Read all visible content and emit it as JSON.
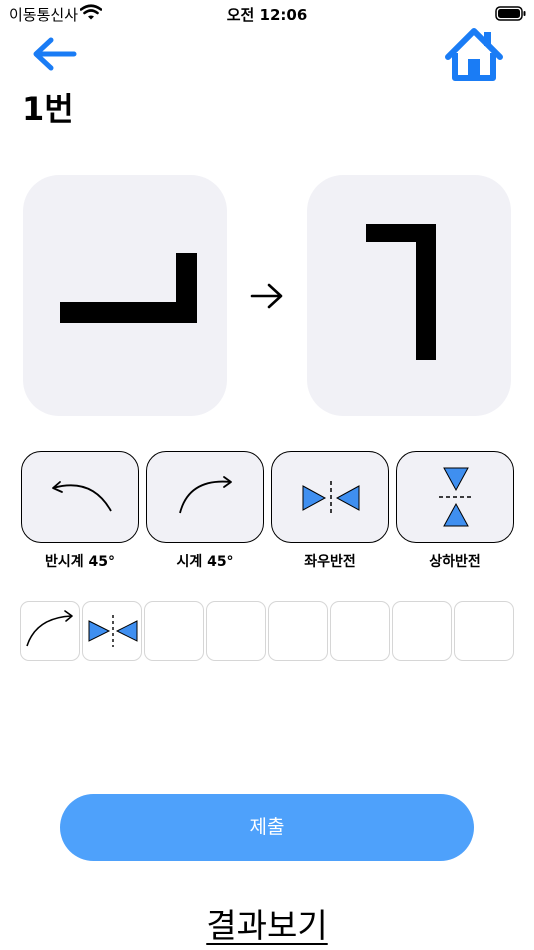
{
  "status_bar": {
    "carrier": "이동통신사",
    "time": "오전 12:06"
  },
  "header": {
    "title": "1번"
  },
  "puzzle": {
    "source_shape": "bracket-bottom-right",
    "target_shape": "bracket-top-right"
  },
  "operations": [
    {
      "label": "반시계 45°",
      "icon": "rotate-ccw-icon"
    },
    {
      "label": "시계 45°",
      "icon": "rotate-cw-icon"
    },
    {
      "label": "좌우반전",
      "icon": "flip-horizontal-icon"
    },
    {
      "label": "상하반전",
      "icon": "flip-vertical-icon"
    }
  ],
  "sequence_slots": [
    "rotate-cw-icon",
    "flip-horizontal-icon",
    "",
    "",
    "",
    "",
    "",
    ""
  ],
  "submit": {
    "label": "제출"
  },
  "result": {
    "label": "결과보기"
  },
  "colors": {
    "accent": "#1a7cf5",
    "submit_bg": "#4ea1fb",
    "triangle": "#3f8ff0",
    "card_bg": "#f1f1f6"
  }
}
